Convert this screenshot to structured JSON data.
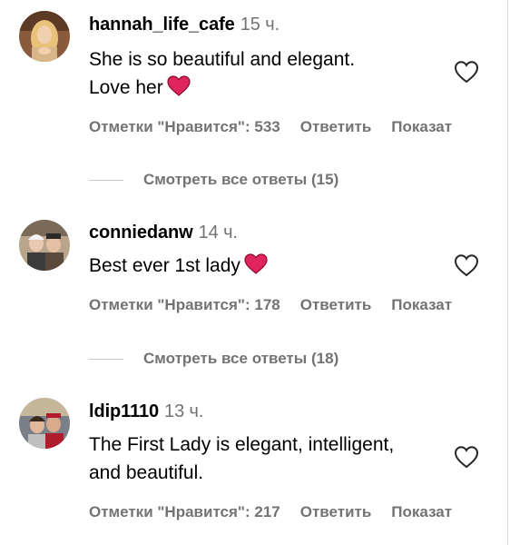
{
  "comments": [
    {
      "username": "hannah_life_cafe",
      "time": "15 ч.",
      "text_lines": [
        "She is so beautiful and elegant.",
        "Love her"
      ],
      "likes_label": "Отметки \"Нравится\": 533",
      "reply_label": "Ответить",
      "show_label": "Показат",
      "emoji": "red-heart",
      "view_replies": "Смотреть все ответы (15)"
    },
    {
      "username": "conniedanw",
      "time": "14 ч.",
      "text_lines": [
        "Best ever 1st lady"
      ],
      "likes_label": "Отметки \"Нравится\": 178",
      "reply_label": "Ответить",
      "show_label": "Показат",
      "emoji": "red-heart",
      "view_replies": "Смотреть все ответы (18)"
    },
    {
      "username": "ldip1110",
      "time": "13 ч.",
      "text_lines": [
        "The First Lady is elegant, intelligent,",
        "and beautiful."
      ],
      "likes_label": "Отметки \"Нравится\": 217",
      "reply_label": "Ответить",
      "show_label": "Показат"
    }
  ],
  "colors": {
    "text": "#000000",
    "secondary": "#737373",
    "heart_emoji": "#e0245e",
    "divider": "#c7c7c7"
  },
  "icons": {
    "like": "heart-outline-icon",
    "emoji": "red-heart-emoji"
  }
}
